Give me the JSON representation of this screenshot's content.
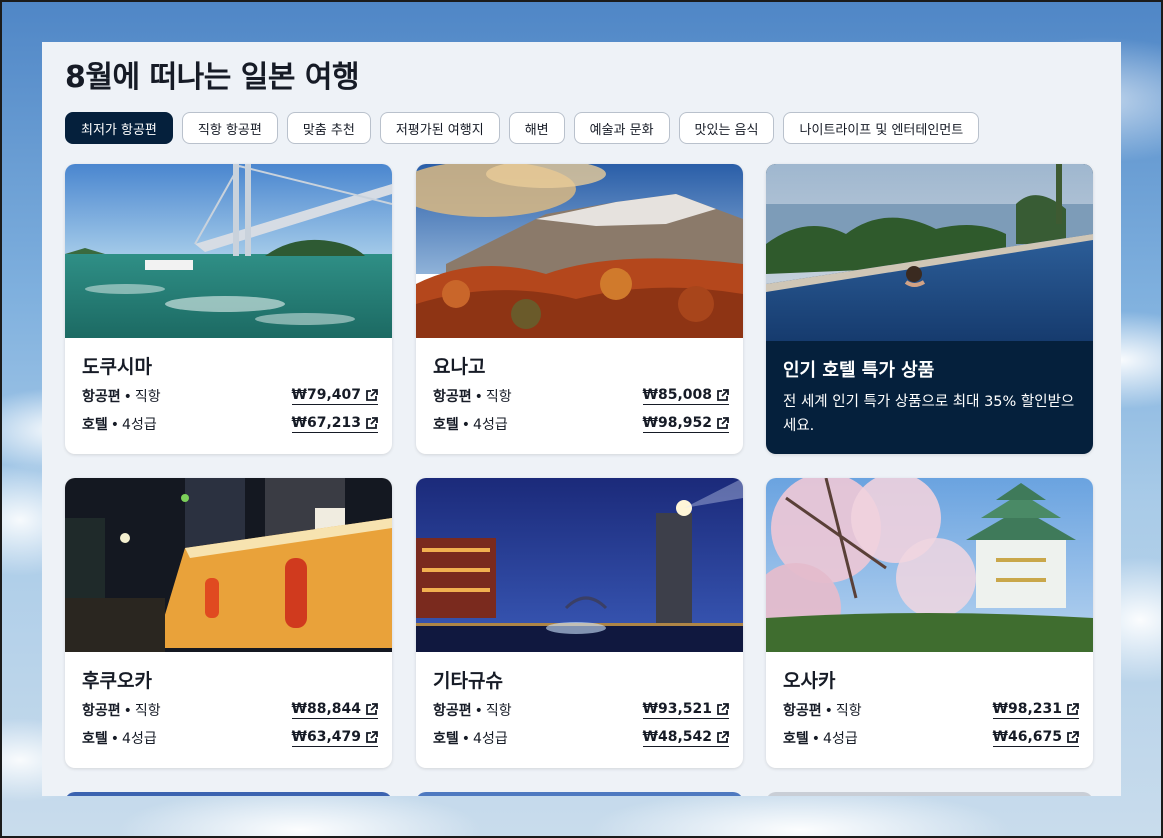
{
  "page": {
    "title": "8월에 떠나는 일본 여행"
  },
  "tabs": [
    {
      "label": "최저가 항공편",
      "active": true
    },
    {
      "label": "직항 항공편",
      "active": false
    },
    {
      "label": "맞춤 추천",
      "active": false
    },
    {
      "label": "저평가된 여행지",
      "active": false
    },
    {
      "label": "해변",
      "active": false
    },
    {
      "label": "예술과 문화",
      "active": false
    },
    {
      "label": "맛있는 음식",
      "active": false
    },
    {
      "label": "나이트라이프 및 엔터테인먼트",
      "active": false
    }
  ],
  "labels": {
    "flight": "항공편",
    "flight_type": "직항",
    "hotel": "호텔",
    "hotel_class": "4성급",
    "separator": "•"
  },
  "cards": [
    {
      "city": "도쿠시마",
      "flight_price": "₩79,407",
      "hotel_price": "₩67,213",
      "image": "bridge-sea-photo"
    },
    {
      "city": "요나고",
      "flight_price": "₩85,008",
      "hotel_price": "₩98,952",
      "image": "autumn-mountain-photo"
    },
    {
      "city": "후쿠오카",
      "flight_price": "₩88,844",
      "hotel_price": "₩63,479",
      "image": "night-street-stalls-photo"
    },
    {
      "city": "기타규슈",
      "flight_price": "₩93,521",
      "hotel_price": "₩48,542",
      "image": "night-harbor-tower-photo"
    },
    {
      "city": "오사카",
      "flight_price": "₩98,231",
      "hotel_price": "₩46,675",
      "image": "castle-cherry-blossom-photo"
    }
  ],
  "promo": {
    "title": "인기 호텔 특가 상품",
    "description": "전 세계 인기 특가 상품으로 최대 35% 할인받으세요.",
    "image": "infinity-pool-photo"
  },
  "colors": {
    "accent_dark": "#05203c",
    "text": "#161b26",
    "panel_bg": "#eef2f7"
  },
  "icons": {
    "price_link": "external-link-icon"
  }
}
